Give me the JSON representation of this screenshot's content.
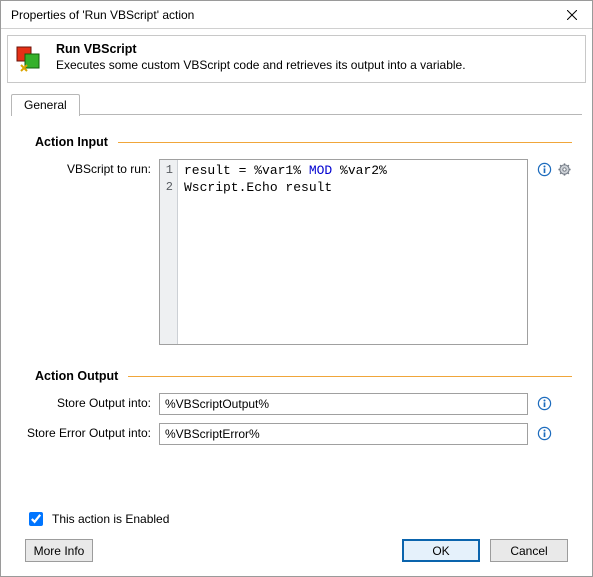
{
  "window": {
    "title": "Properties of 'Run VBScript' action"
  },
  "header": {
    "title": "Run VBScript",
    "description": "Executes some custom VBScript code and retrieves its output into a variable."
  },
  "tabs": {
    "general": "General"
  },
  "sections": {
    "input_title": "Action Input",
    "output_title": "Action Output"
  },
  "input": {
    "vbscript_label": "VBScript to run:",
    "code": {
      "line1_pre": "result = %var1% ",
      "line1_kw": "MOD",
      "line1_post": " %var2%",
      "line2": "Wscript.Echo result",
      "ln1": "1",
      "ln2": "2"
    }
  },
  "output": {
    "store_output_label": "Store Output into:",
    "store_output_value": "%VBScriptOutput%",
    "store_error_label": "Store Error Output into:",
    "store_error_value": "%VBScriptError%"
  },
  "footer": {
    "enabled_label": "This action is Enabled",
    "enabled_checked": true,
    "more_info": "More Info",
    "ok": "OK",
    "cancel": "Cancel"
  }
}
